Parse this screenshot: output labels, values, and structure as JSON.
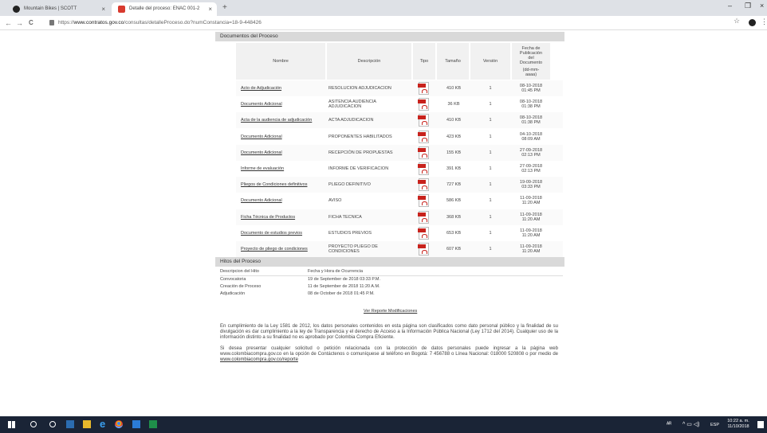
{
  "browser": {
    "tabs": [
      {
        "title": "Mountain Bikes | SCOTT"
      },
      {
        "title": "Detalle del proceso: ENAC 001-2"
      }
    ],
    "new_tab": "+",
    "tab_close": "×",
    "window_controls": {
      "minimize": "–",
      "maximize": "❐",
      "close": "×"
    },
    "nav": {
      "back": "←",
      "forward": "→",
      "reload": "C"
    },
    "url_prefix": "https://",
    "url_host": "www.contratos.gov.co",
    "url_path": "/consultas/detalleProceso.do?numConstancia=18-9-448426",
    "star": "☆",
    "menu": "⋮"
  },
  "documentos": {
    "header": "Documentos del Proceso",
    "columns": {
      "nombre": "Nombre",
      "descripcion": "Descripción",
      "tipo": "Tipo",
      "tamano": "Tamaño",
      "version": "Versión",
      "fecha_l1": "Fecha de",
      "fecha_l2": "Publicación",
      "fecha_l3": "del",
      "fecha_l4": "Documento",
      "fecha_l5": "(dd-mm-",
      "fecha_l6": "aaaa)"
    },
    "rows": [
      {
        "nombre": "Acto de Adjudicación",
        "desc1": "RESOLUCION ADJUDICACION",
        "desc2": "",
        "tamano": "410 KB",
        "version": "1",
        "fecha1": "08-10-2018",
        "fecha2": "01:45 PM"
      },
      {
        "nombre": "Documento Adicional",
        "desc1": "ASITENCIA AUDIENCIA",
        "desc2": "ADJUDICACION",
        "tamano": "36 KB",
        "version": "1",
        "fecha1": "08-10-2018",
        "fecha2": "01:38 PM"
      },
      {
        "nombre": "Acta de la audiencia de adjudicación",
        "desc1": "ACTA ADJUDICACION",
        "desc2": "",
        "tamano": "410 KB",
        "version": "1",
        "fecha1": "08-10-2018",
        "fecha2": "01:38 PM"
      },
      {
        "nombre": "Documento Adicional",
        "desc1": "PROPONENTES HABILITADOS",
        "desc2": "",
        "tamano": "423 KB",
        "version": "1",
        "fecha1": "04-10-2018",
        "fecha2": "08:09 AM"
      },
      {
        "nombre": "Documento Adicional",
        "desc1": "RECEPCIÓN DE PROPUESTAS",
        "desc2": "",
        "tamano": "155 KB",
        "version": "1",
        "fecha1": "27-09-2018",
        "fecha2": "02:13 PM"
      },
      {
        "nombre": "Informe de evaluación",
        "desc1": "INFORME DE VERIFICACION",
        "desc2": "",
        "tamano": "391 KB",
        "version": "1",
        "fecha1": "27-09-2018",
        "fecha2": "02:13 PM"
      },
      {
        "nombre": "Pliegos de Condiciones definitivos",
        "desc1": "PLIEGO DEFINITIVO",
        "desc2": "",
        "tamano": "727 KB",
        "version": "1",
        "fecha1": "19-09-2018",
        "fecha2": "03:33 PM"
      },
      {
        "nombre": "Documento Adicional",
        "desc1": "AVISO",
        "desc2": "",
        "tamano": "586 KB",
        "version": "1",
        "fecha1": "11-09-2018",
        "fecha2": "11:20 AM"
      },
      {
        "nombre": "Ficha Técnica de Productos",
        "desc1": "FICHA TECNICA",
        "desc2": "",
        "tamano": "368 KB",
        "version": "1",
        "fecha1": "11-09-2018",
        "fecha2": "11:20 AM"
      },
      {
        "nombre": "Documento de estudios previos",
        "desc1": "ESTUDIOS PREVIOS",
        "desc2": "",
        "tamano": "653 KB",
        "version": "1",
        "fecha1": "11-09-2018",
        "fecha2": "11:20 AM"
      },
      {
        "nombre": "Proyecto de pliego de condiciones",
        "desc1": "PROYECTO PLIEGO DE",
        "desc2": "CONDICIONES",
        "tamano": "607 KB",
        "version": "1",
        "fecha1": "11-09-2018",
        "fecha2": "11:20 AM"
      }
    ]
  },
  "hitos": {
    "header": "Hitos del Proceso",
    "col_desc": "Descripcion del Hito",
    "col_fecha": "Fecha y Hora de Ocurrencia",
    "rows": [
      {
        "desc": "Convocatoria",
        "fecha": "19 de September de 2018 03:33 P.M."
      },
      {
        "desc": "Creación de Proceso",
        "fecha": "11 de September de 2018 11:20 A.M."
      },
      {
        "desc": "Adjudicación",
        "fecha": "08 de October de 2018 01:45 P.M."
      }
    ]
  },
  "reporte_link": "Ver Reporte Modificaciones",
  "legal1": "En cumplimiento de la Ley 1581 de 2012, los datos personales contenidos en esta página son clasificados como dato personal público y la finalidad de su divulgación es dar cumplimiento a la ley de Transparencia y el derecho de Acceso a la Información Pública Nacional (Ley 1712 del 2014). Cualquier uso de la información distinto a su finalidad no es aprobado por Colombia Compra Eficiente.",
  "legal2": "Si desea presentar cualquier solicitud o petición relacionada con la protección de datos personales puede ingresar a la página web www.colombiacompra.gov.co en la opción de Contáctenos o comuníquese al teléfono en Bogotá: 7 456788 o Línea Nacional: 018000 520808 o por medio de",
  "legal2_link": "www.colombiacompra.gov.co/reporte",
  "taskbar": {
    "lang": "ESP",
    "time": "10:22 a. m.",
    "date": "11/10/2018"
  }
}
